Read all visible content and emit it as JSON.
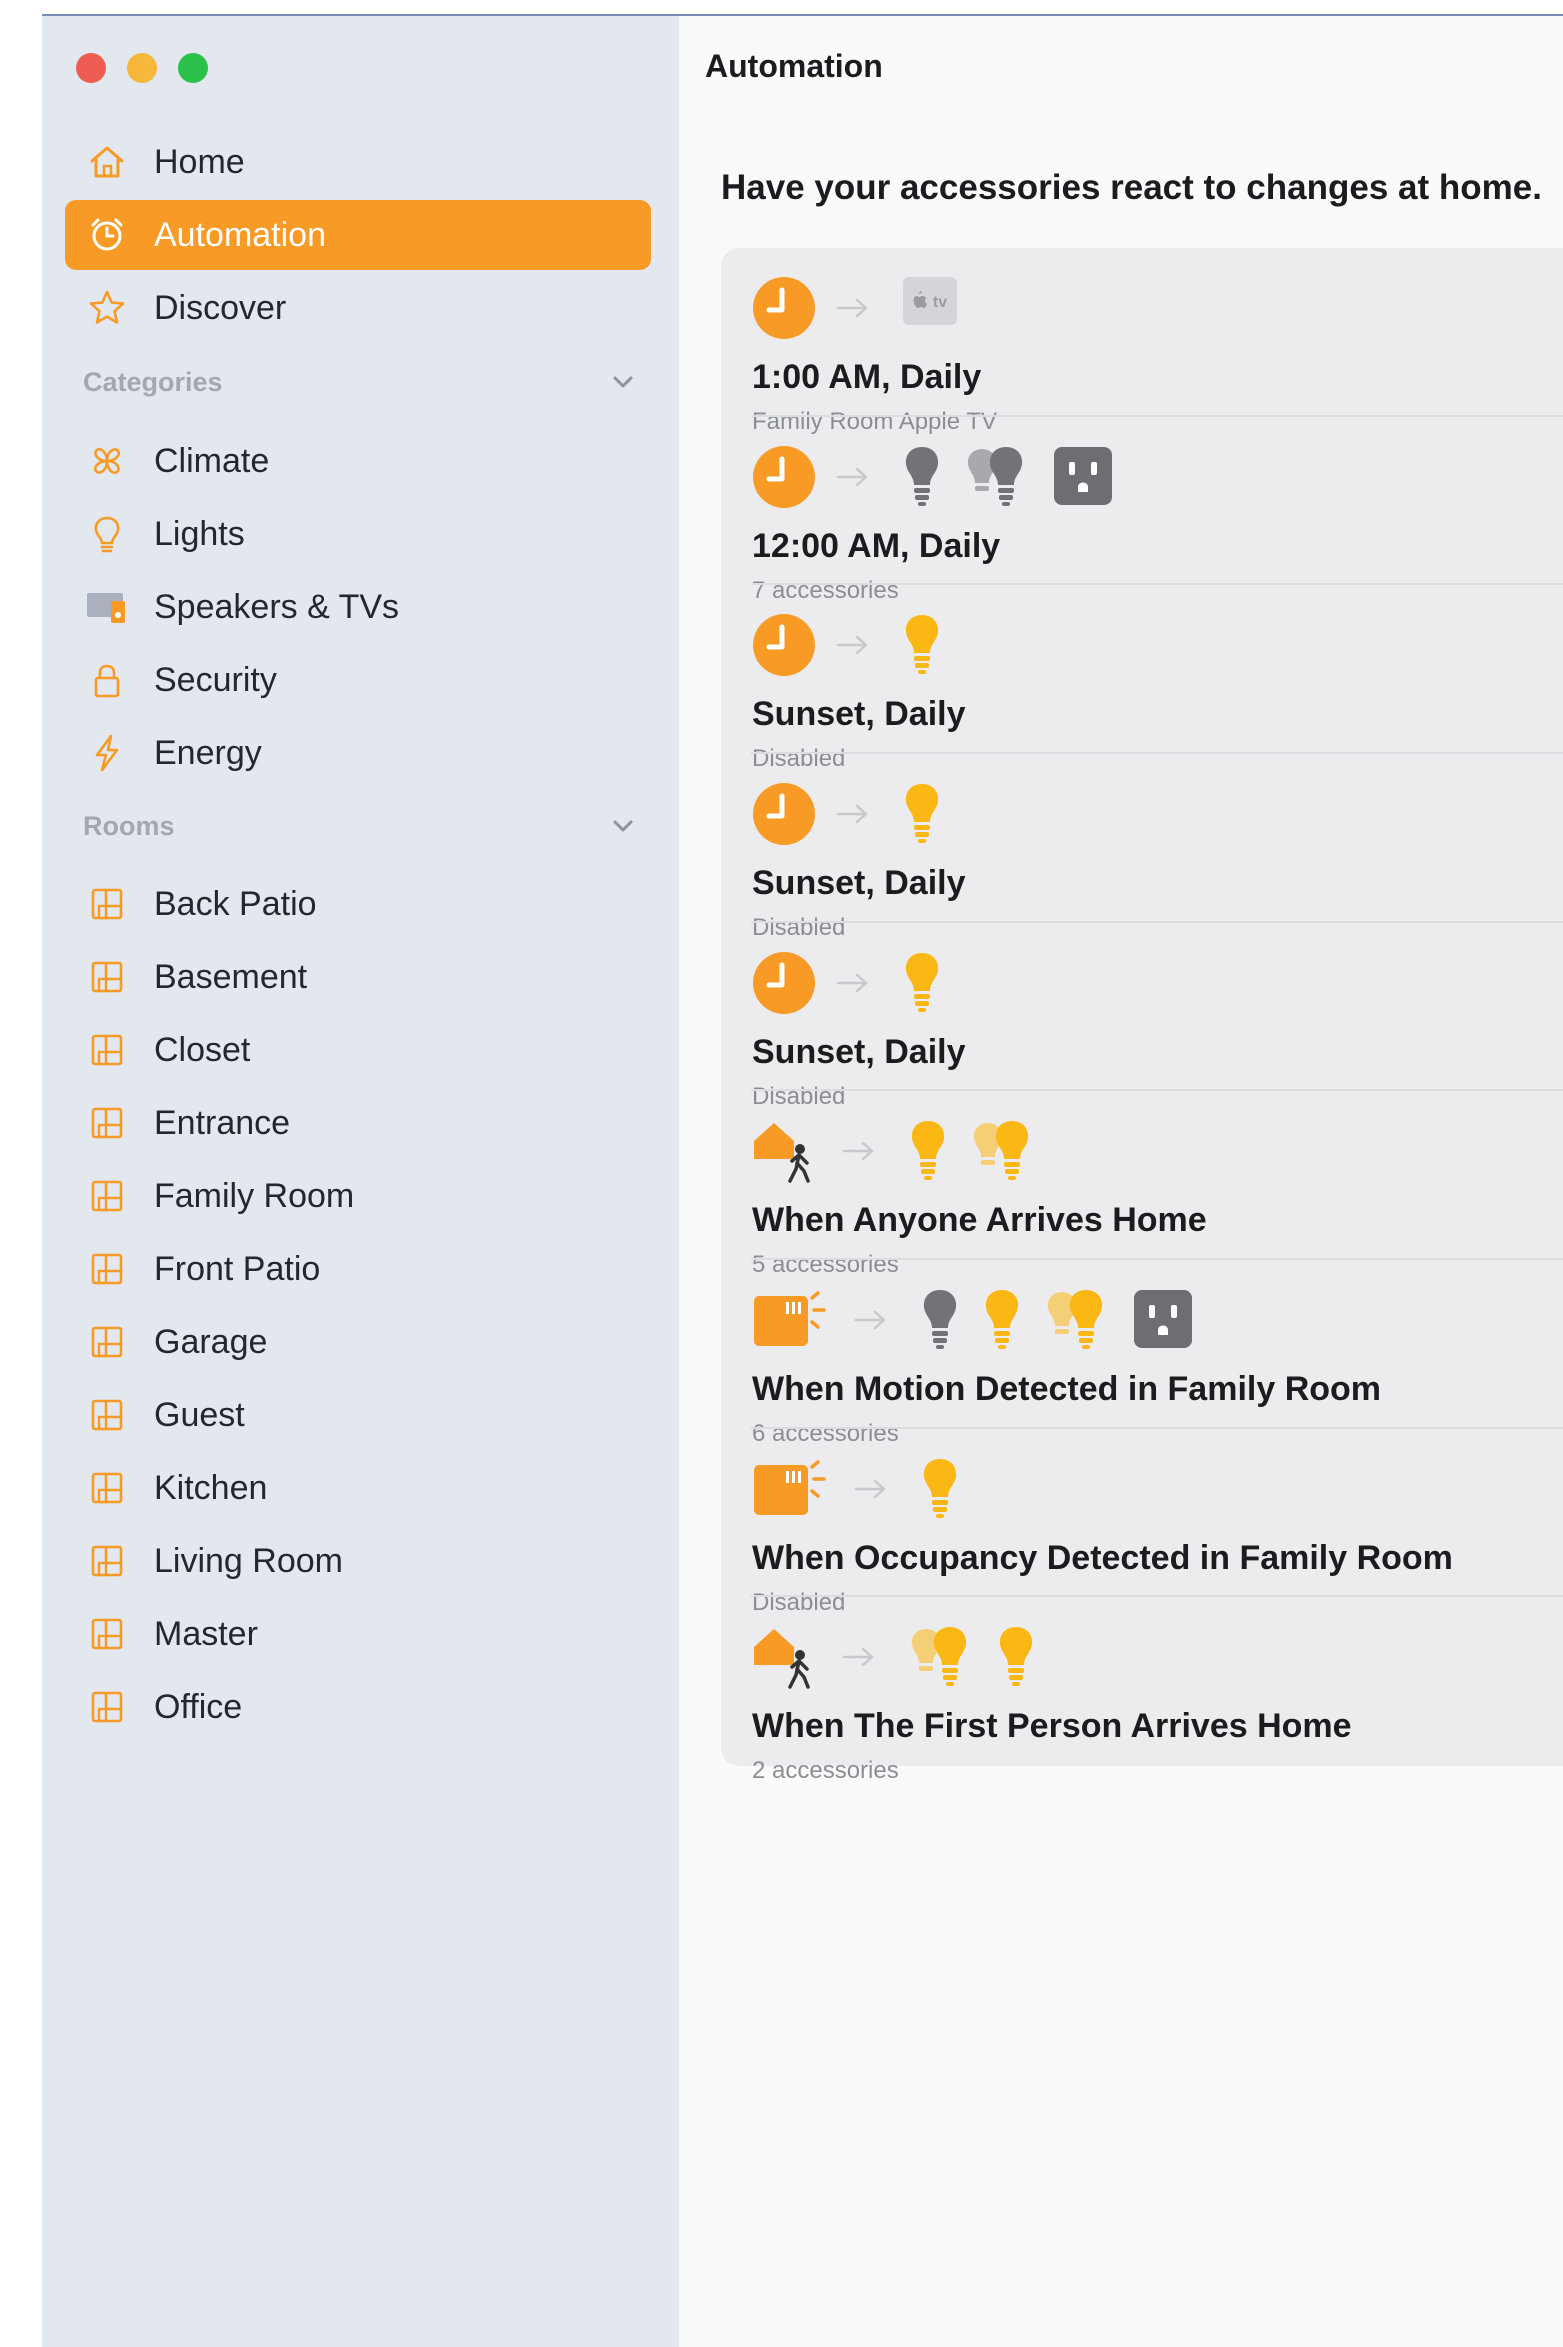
{
  "colors": {
    "accent": "#f79a26",
    "sidebar_bg": "#e3e7ee",
    "bulb_on": "#fbb814",
    "bulb_off": "#717378",
    "outlet": "#6c6e73"
  },
  "sidebar": {
    "nav": [
      {
        "label": "Home",
        "icon": "house-icon"
      },
      {
        "label": "Automation",
        "icon": "clock-automation-icon",
        "active": true
      },
      {
        "label": "Discover",
        "icon": "star-icon"
      }
    ],
    "categories_header": "Categories",
    "categories": [
      {
        "label": "Climate",
        "icon": "fan-icon"
      },
      {
        "label": "Lights",
        "icon": "lightbulb-icon"
      },
      {
        "label": "Speakers & TVs",
        "icon": "speaker-tv-icon"
      },
      {
        "label": "Security",
        "icon": "lock-icon"
      },
      {
        "label": "Energy",
        "icon": "bolt-icon"
      }
    ],
    "rooms_header": "Rooms",
    "rooms": [
      {
        "label": "Back Patio"
      },
      {
        "label": "Basement"
      },
      {
        "label": "Closet"
      },
      {
        "label": "Entrance"
      },
      {
        "label": "Family Room"
      },
      {
        "label": "Front Patio"
      },
      {
        "label": "Garage"
      },
      {
        "label": "Guest"
      },
      {
        "label": "Kitchen"
      },
      {
        "label": "Living Room"
      },
      {
        "label": "Master"
      },
      {
        "label": "Office"
      }
    ]
  },
  "main": {
    "title": "Automation",
    "subtitle": "Have your accessories react to changes at home.",
    "automations": [
      {
        "title": "1:00 AM, Daily",
        "subtitle": "Family Room Apple TV",
        "trigger": "clock-icon",
        "targets": [
          "appletv-icon"
        ]
      },
      {
        "title": "12:00 AM, Daily",
        "subtitle": "7 accessories",
        "trigger": "clock-icon",
        "targets": [
          "bulb-off-icon",
          "bulb-group-off-icon",
          "outlet-icon"
        ]
      },
      {
        "title": "Sunset, Daily",
        "subtitle": "Disabled",
        "trigger": "clock-icon",
        "targets": [
          "bulb-on-icon"
        ]
      },
      {
        "title": "Sunset, Daily",
        "subtitle": "Disabled",
        "trigger": "clock-icon",
        "targets": [
          "bulb-on-icon"
        ]
      },
      {
        "title": "Sunset, Daily",
        "subtitle": "Disabled",
        "trigger": "clock-icon",
        "targets": [
          "bulb-on-icon"
        ]
      },
      {
        "title": "When Anyone Arrives Home",
        "subtitle": "5 accessories",
        "trigger": "home-person-icon",
        "targets": [
          "bulb-on-icon",
          "bulb-group-on-icon"
        ]
      },
      {
        "title": "When Motion Detected in Family Room",
        "subtitle": "6 accessories",
        "trigger": "motion-sensor-icon",
        "targets": [
          "bulb-off-icon",
          "bulb-on-icon",
          "bulb-group-on-icon",
          "outlet-icon"
        ]
      },
      {
        "title": "When Occupancy Detected in Family Room",
        "subtitle": "Disabled",
        "trigger": "motion-sensor-icon",
        "targets": [
          "bulb-on-icon"
        ]
      },
      {
        "title": "When The First Person Arrives Home",
        "subtitle": "2 accessories",
        "trigger": "home-person-icon",
        "targets": [
          "bulb-group-on-icon",
          "bulb-on-icon"
        ]
      }
    ]
  }
}
